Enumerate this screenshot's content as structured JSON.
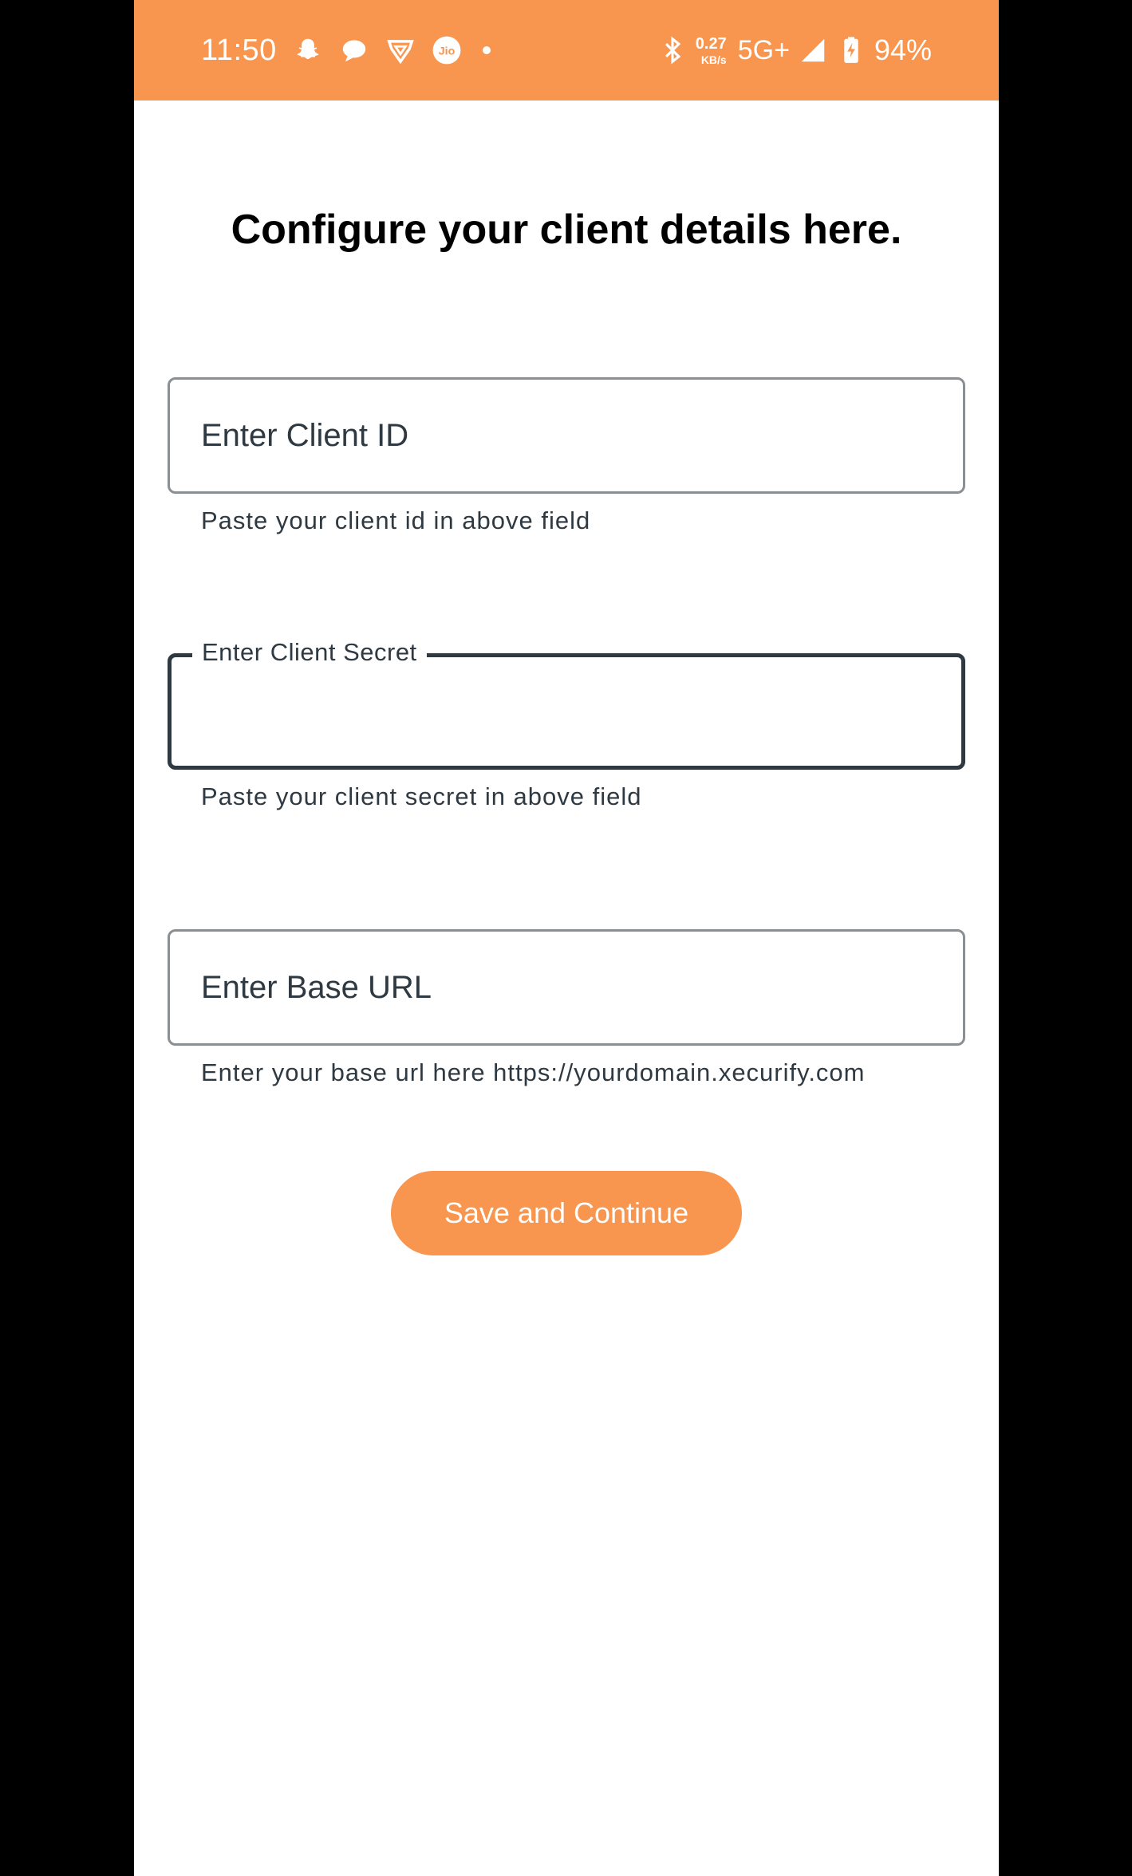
{
  "status_bar": {
    "time": "11:50",
    "left_icons": [
      "snapchat-icon",
      "chat-bubble-icon",
      "vpn-shield-icon",
      "jio-icon"
    ],
    "net_speed_value": "0.27",
    "net_speed_unit": "KB/s",
    "network_type": "5G+",
    "battery_percent": "94%",
    "background_color": "#f8954e"
  },
  "title": "Configure your client details here.",
  "fields": {
    "client_id": {
      "placeholder": "Enter Client ID",
      "value": "",
      "helper": "Paste your client id in above field"
    },
    "client_secret": {
      "label": "Enter Client Secret",
      "value": "",
      "helper": "Paste your client secret in above field"
    },
    "base_url": {
      "placeholder": "Enter Base URL",
      "value": "",
      "helper": "Enter your base url here https://yourdomain.xecurify.com"
    }
  },
  "button": {
    "label": "Save and Continue",
    "color": "#f8954e"
  }
}
